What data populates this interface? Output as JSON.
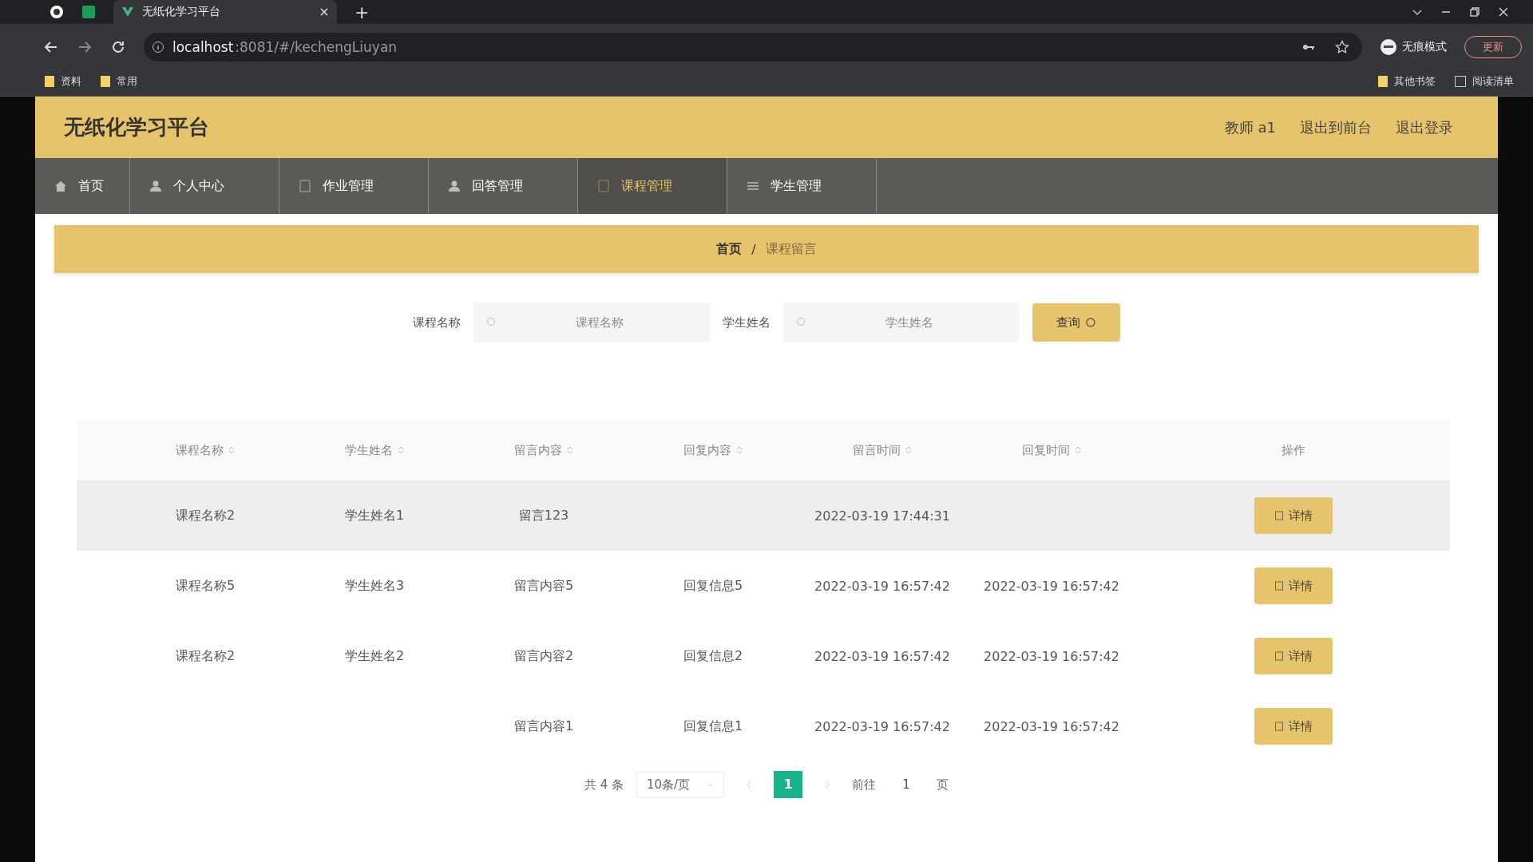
{
  "browser": {
    "tabs": [
      {
        "title": "无纸化学习平台",
        "selected": true
      }
    ],
    "new_tab": "+",
    "url_host": "localhost",
    "url_rest": ":8081/#/kechengLiuyan",
    "incognito": "无痕模式",
    "update": "更新",
    "bookmarks": [
      {
        "label": "资料"
      },
      {
        "label": "常用"
      }
    ],
    "bookmarks_right": [
      {
        "label": "其他书签",
        "kind": "folder"
      },
      {
        "label": "阅读清单",
        "kind": "list"
      }
    ]
  },
  "header": {
    "title": "无纸化学习平台",
    "links": [
      "教师 a1",
      "退出到前台",
      "退出登录"
    ]
  },
  "nav": [
    {
      "label": "首页",
      "selected": false,
      "kind": "home"
    },
    {
      "label": "个人中心",
      "selected": false,
      "kind": "user"
    },
    {
      "label": "作业管理",
      "selected": false,
      "kind": "doc"
    },
    {
      "label": "回答管理",
      "selected": false,
      "kind": "user"
    },
    {
      "label": "课程管理",
      "selected": true,
      "kind": "doc"
    },
    {
      "label": "学生管理",
      "selected": false,
      "kind": "list"
    }
  ],
  "breadcrumb": [
    "首页",
    "课程留言"
  ],
  "breadcrumb_separator": "/",
  "search": {
    "fields": [
      {
        "label": "课程名称",
        "placeholder": "课程名称"
      },
      {
        "label": "学生姓名",
        "placeholder": "学生姓名"
      }
    ],
    "button": "查询"
  },
  "table": {
    "columns": [
      "课程名称",
      "学生姓名",
      "留言内容",
      "回复内容",
      "留言时间",
      "回复时间",
      "操作"
    ],
    "rows": [
      {
        "hover": true,
        "cells": [
          "课程名称2",
          "学生姓名1",
          "留言123",
          null,
          "2022-03-19 17:44:31",
          null
        ],
        "action": "详情"
      },
      {
        "hover": false,
        "cells": [
          "课程名称5",
          "学生姓名3",
          "留言内容5",
          "回复信息5",
          "2022-03-19 16:57:42",
          "2022-03-19 16:57:42"
        ],
        "action": "详情"
      },
      {
        "hover": false,
        "cells": [
          "课程名称2",
          "学生姓名2",
          "留言内容2",
          "回复信息2",
          "2022-03-19 16:57:42",
          "2022-03-19 16:57:42"
        ],
        "action": "详情"
      },
      {
        "hover": false,
        "cells": [
          null,
          null,
          "留言内容1",
          "回复信息1",
          "2022-03-19 16:57:42",
          "2022-03-19 16:57:42"
        ],
        "action": "详情"
      }
    ]
  },
  "pagination": {
    "total": "共 4 条",
    "page_size": "10条/页",
    "pages": [
      {
        "label": "1",
        "selected": true
      }
    ],
    "goto": "前往",
    "goto_value": "1",
    "goto_suffix": "页"
  }
}
